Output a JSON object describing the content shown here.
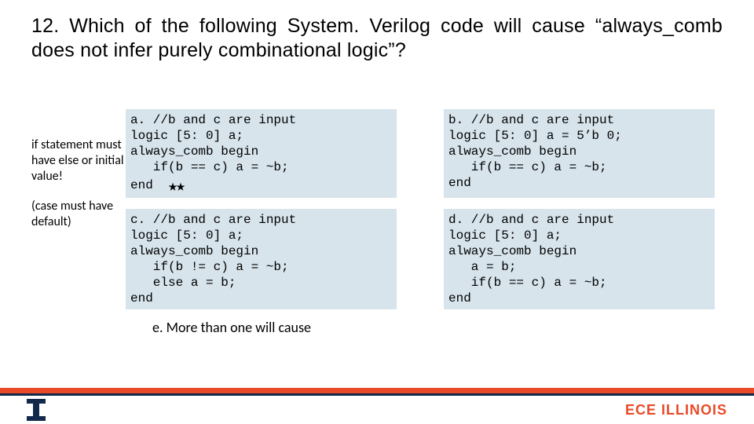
{
  "question": "12.  Which  of  the  following  System. Verilog  code  will  cause “always_comb does not infer purely combinational logic”?",
  "sidenote": {
    "line1": "if statement must have else or initial value!",
    "line2": "(case must have default)"
  },
  "options": {
    "a": "a. //b and c are input\nlogic [5: 0] a;\nalways_comb begin\n   if(b == c) a = ~b;\nend  ",
    "a_stars": "★★",
    "b": "b. //b and c are input\nlogic [5: 0] a = 5’b 0;\nalways_comb begin\n   if(b == c) a = ~b;\nend",
    "c": "c. //b and c are input\nlogic [5: 0] a;\nalways_comb begin\n   if(b != c) a = ~b;\n   else a = b;\nend",
    "d": "d. //b and c are input\nlogic [5: 0] a;\nalways_comb begin\n   a = b;\n   if(b == c) a = ~b;\nend",
    "e": "e. More than one will cause"
  },
  "footer": {
    "brand": "ECE ILLINOIS"
  }
}
